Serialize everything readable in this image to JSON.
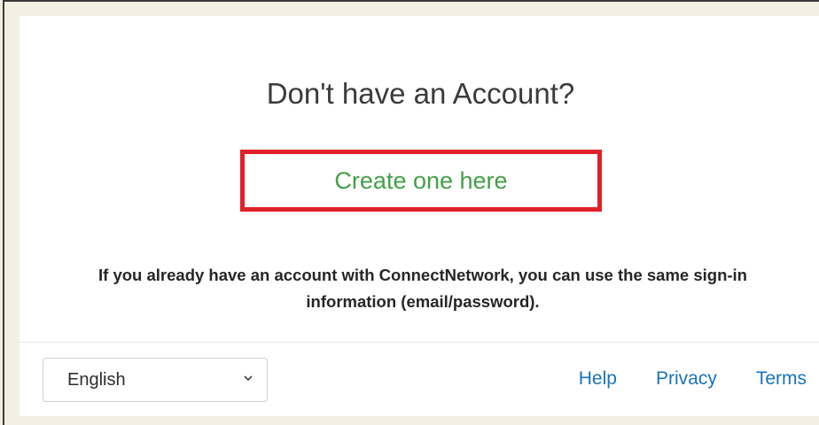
{
  "signup": {
    "heading": "Don't have an Account?",
    "create_link": "Create one here",
    "info": "If you already have an account with ConnectNetwork, you can use the same sign-in information (email/password)."
  },
  "footer": {
    "language": "English",
    "links": {
      "help": "Help",
      "privacy": "Privacy",
      "terms": "Terms"
    }
  },
  "colors": {
    "background": "#f3efe3",
    "link_green": "#43a047",
    "link_blue": "#1a73b8",
    "highlight_red": "#e0202a"
  }
}
